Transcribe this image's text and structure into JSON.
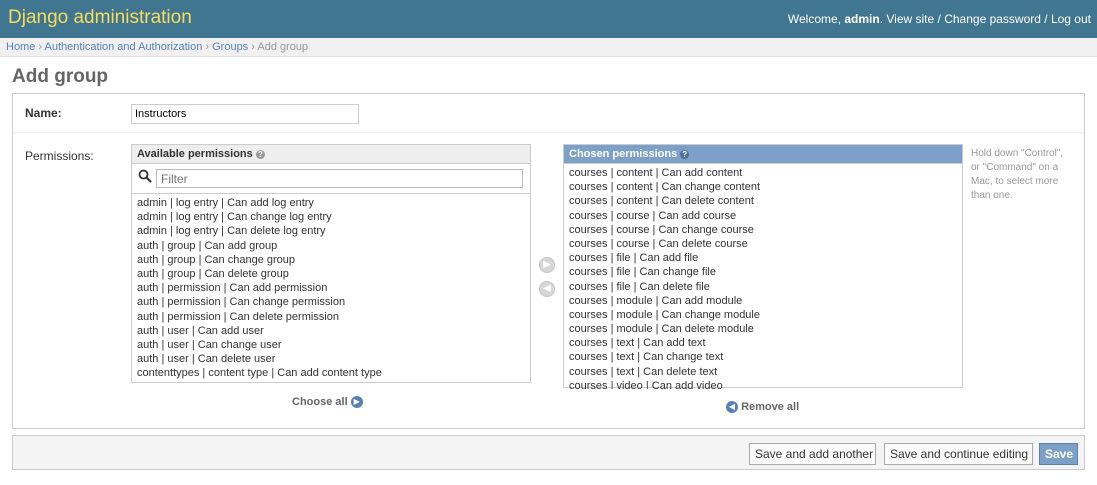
{
  "header": {
    "branding": "Django administration",
    "welcome": "Welcome, ",
    "username": "admin",
    "view_site": "View site",
    "sep": " / ",
    "change_password": "Change password",
    "log_out": "Log out"
  },
  "breadcrumbs": {
    "home": "Home",
    "app": "Authentication and Authorization",
    "model": "Groups",
    "current": "Add group",
    "separator": "›"
  },
  "title": "Add group",
  "form": {
    "name_label": "Name:",
    "name_value": "Instructors",
    "permissions_label": "Permissions:",
    "available_title": "Available permissions",
    "filter_placeholder": "Filter",
    "available_options": [
      "admin | log entry | Can add log entry",
      "admin | log entry | Can change log entry",
      "admin | log entry | Can delete log entry",
      "auth | group | Can add group",
      "auth | group | Can change group",
      "auth | group | Can delete group",
      "auth | permission | Can add permission",
      "auth | permission | Can change permission",
      "auth | permission | Can delete permission",
      "auth | user | Can add user",
      "auth | user | Can change user",
      "auth | user | Can delete user",
      "contenttypes | content type | Can add content type"
    ],
    "chosen_title": "Chosen permissions",
    "chosen_options": [
      "courses | content | Can add content",
      "courses | content | Can change content",
      "courses | content | Can delete content",
      "courses | course | Can add course",
      "courses | course | Can change course",
      "courses | course | Can delete course",
      "courses | file | Can add file",
      "courses | file | Can change file",
      "courses | file | Can delete file",
      "courses | module | Can add module",
      "courses | module | Can change module",
      "courses | module | Can delete module",
      "courses | text | Can add text",
      "courses | text | Can change text",
      "courses | text | Can delete text",
      "courses | video | Can add video"
    ],
    "choose_all": "Choose all",
    "remove_all": "Remove all",
    "help_text": "Hold down \"Control\", or \"Command\" on a Mac, to select more than one."
  },
  "submit": {
    "save_add_another": "Save and add another",
    "save_continue": "Save and continue editing",
    "save": "Save"
  },
  "colors": {
    "header_bg": "#417690",
    "branding": "#f5dd5d",
    "link": "#5b80b2",
    "chosen_header": "#7ca0c7"
  },
  "icons": {
    "search": "magnifier",
    "add": "circle-right-arrow",
    "remove": "circle-left-arrow",
    "help": "question-circle"
  }
}
